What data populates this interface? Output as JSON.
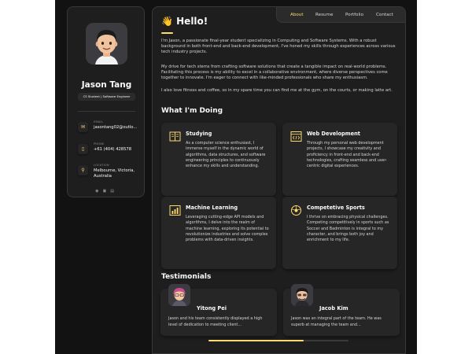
{
  "profile": {
    "name": "Jason Tang",
    "title": "CS Student | Software Engineer",
    "contacts": [
      {
        "label": "Email",
        "value": "jasontang02@outlo...",
        "icon": "mail-icon"
      },
      {
        "label": "Phone",
        "value": "+61 (404) 428578",
        "icon": "phone-icon"
      },
      {
        "label": "Location",
        "value": "Melbourne, Victoria, Australia",
        "icon": "location-icon"
      }
    ],
    "socials": [
      "github-icon",
      "linkedin-icon",
      "resume-icon"
    ]
  },
  "nav": {
    "items": [
      "About",
      "Resume",
      "Portfolio",
      "Contact"
    ],
    "active": "About"
  },
  "about": {
    "heading_emoji": "👋",
    "heading": "Hello!",
    "paragraphs": [
      "I'm Jason, a passionate final-year student specializing in Computing and Software Systems. With a robust background in both front-end and back-end development, I've honed my skills through experiences across various tech industry projects.",
      "My drive for tech stems from crafting software solutions that create a tangible impact on real-world problems. Facilitating this process is my ability to excel in a collaborative environment, where diverse perspectives come together to innovate. I'm eager to connect with like-minded professionals who share my enthusiasm.",
      "I also love fitness and coffee, so in my spare time you can find me at the gym, on the courts, or making latte art."
    ]
  },
  "services": {
    "title": "What I'm Doing",
    "items": [
      {
        "title": "Studying",
        "icon": "book-icon",
        "text": "As a computer science enthusiast, I immerse myself in the dynamic world of algorithms, data structures, and software engineering principles to continuously enhance my skills and understanding."
      },
      {
        "title": "Web Development",
        "icon": "code-icon",
        "text": "Through my personal web development projects, I showcase my creativity and proficiency in front-end and back-end technologies, crafting seamless and user-centric digital experiences."
      },
      {
        "title": "Machine Learning",
        "icon": "chart-icon",
        "text": "Leveraging cutting-edge API models and algorithms, I delve into the realm of machine learning, exploring its potential to revolutionize industries and solve complex problems with data-driven insights."
      },
      {
        "title": "Competetive Sports",
        "icon": "ball-icon",
        "text": "I thrive on embracing physical challenges. Competing competitively in sports such as Soccer and Badminton is integral to my character, and brings both joy and enrichment to my life."
      }
    ]
  },
  "testimonials": {
    "title": "Testimonials",
    "items": [
      {
        "name": "Yitong Pei",
        "text": "Jason and his team consistently displayed a high level of dedication to meeting client..."
      },
      {
        "name": "Jacob Kim",
        "text": "Jason was an integral part of the team. He was superb at managing the team and..."
      }
    ],
    "scroll_progress": 0.68
  },
  "colors": {
    "accent": "#ffdb70",
    "background": "#121212",
    "card": "#262627",
    "panel": "#1e1e1f"
  }
}
